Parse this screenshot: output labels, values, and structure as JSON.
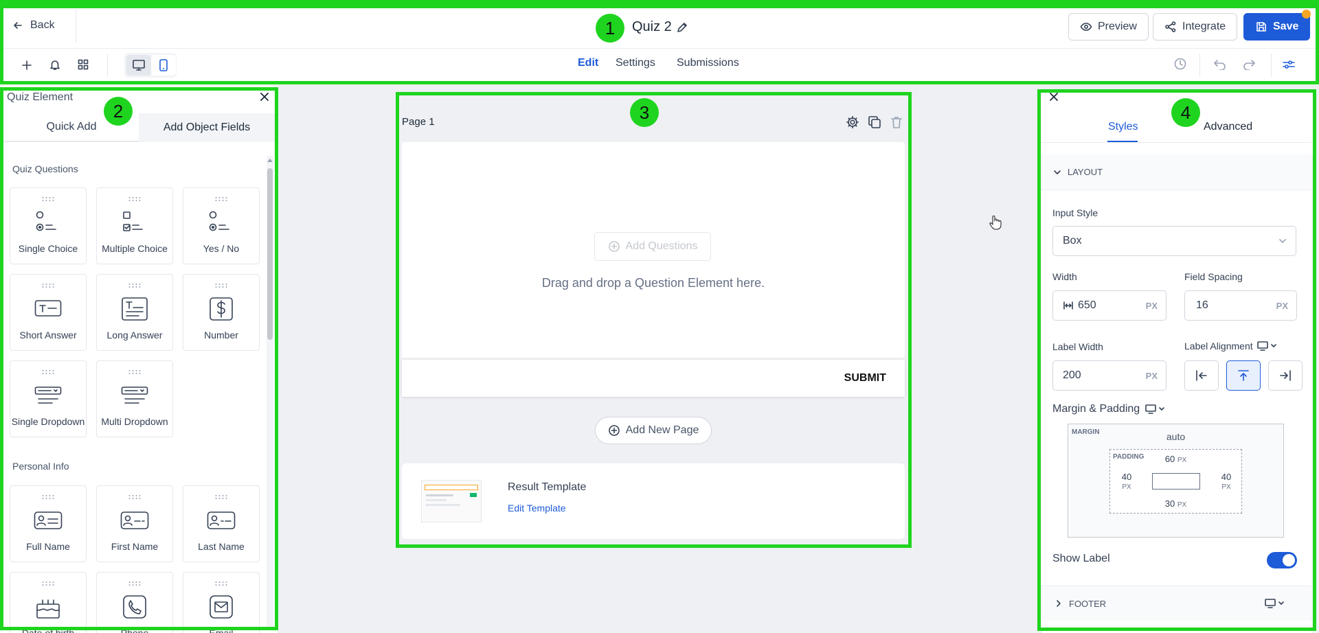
{
  "header": {
    "back_label": "Back",
    "title": "Quiz 2",
    "preview_label": "Preview",
    "integrate_label": "Integrate",
    "save_label": "Save"
  },
  "nav": {
    "tabs": [
      {
        "label": "Edit"
      },
      {
        "label": "Settings"
      },
      {
        "label": "Submissions"
      }
    ]
  },
  "badges": [
    "1",
    "2",
    "3",
    "4"
  ],
  "left_panel": {
    "title": "Quiz Element",
    "tab_quick_add": "Quick Add",
    "tab_object_fields": "Add Object Fields",
    "quiz_section": "Quiz Questions",
    "quiz_items": [
      {
        "label": "Single Choice"
      },
      {
        "label": "Multiple Choice"
      },
      {
        "label": "Yes / No"
      },
      {
        "label": "Short Answer"
      },
      {
        "label": "Long Answer"
      },
      {
        "label": "Number"
      },
      {
        "label": "Single Dropdown"
      },
      {
        "label": "Multi Dropdown"
      }
    ],
    "personal_section": "Personal Info",
    "personal_items": [
      {
        "label": "Full Name"
      },
      {
        "label": "First Name"
      },
      {
        "label": "Last Name"
      },
      {
        "label": "Date of birth"
      },
      {
        "label": "Phone"
      },
      {
        "label": "Email"
      }
    ]
  },
  "canvas": {
    "page_label": "Page 1",
    "add_questions_label": "Add Questions",
    "drop_hint": "Drag and drop a Question Element here.",
    "submit_label": "SUBMIT",
    "add_page_label": "Add New Page",
    "result_title": "Result Template",
    "edit_template_label": "Edit Template"
  },
  "right_panel": {
    "tab_styles": "Styles",
    "tab_advanced": "Advanced",
    "layout_section": "LAYOUT",
    "input_style_label": "Input Style",
    "input_style_value": "Box",
    "width_label": "Width",
    "width_value": "650",
    "field_spacing_label": "Field Spacing",
    "field_spacing_value": "16",
    "unit": "PX",
    "label_width_label": "Label Width",
    "label_width_value": "200",
    "label_alignment_label": "Label Alignment",
    "margin_padding_label": "Margin & Padding",
    "margin_label": "MARGIN",
    "margin_top": "auto",
    "padding_label": "PADDING",
    "padding_top": "60",
    "padding_left": "40",
    "padding_right": "40",
    "padding_bottom": "30",
    "show_label": "Show Label",
    "footer_section": "FOOTER"
  },
  "colors": {
    "accent": "#1e5bd8",
    "highlight": "#1fd41f",
    "save_bg": "#1e5bd8"
  }
}
